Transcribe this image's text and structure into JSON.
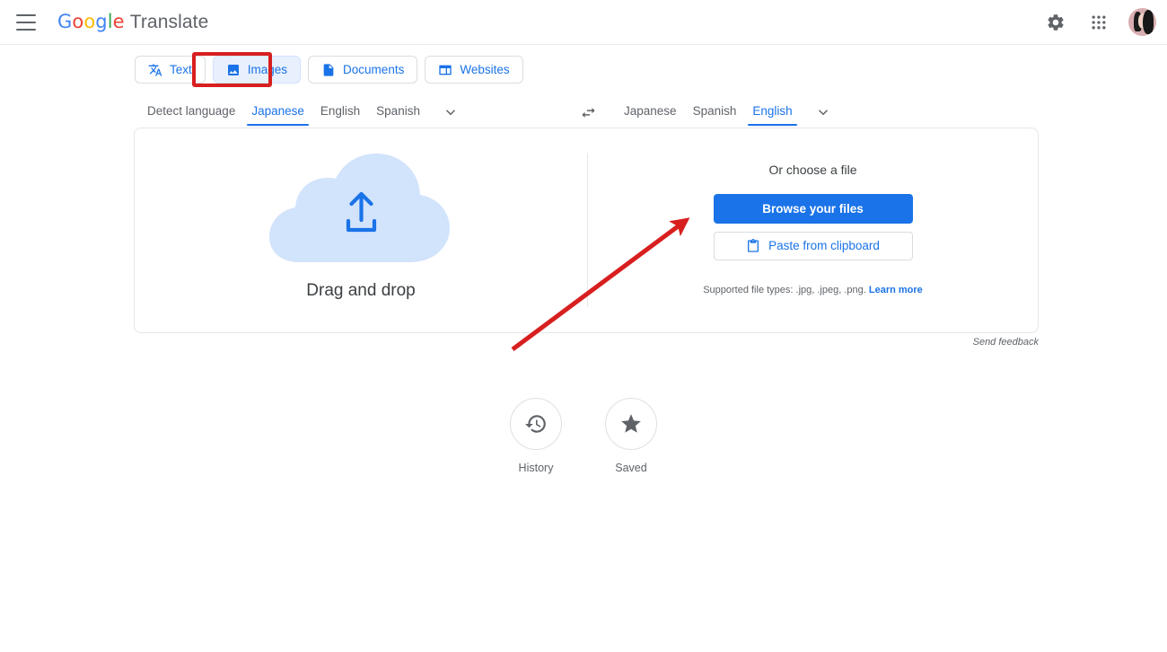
{
  "header": {
    "menu_icon": "hamburger-menu-icon",
    "logo_text": "Google",
    "product_name": "Translate",
    "settings_icon": "gear-icon",
    "apps_icon": "apps-grid-icon",
    "avatar_icon": "user-avatar"
  },
  "tabs": [
    {
      "label": "Text",
      "icon": "translate-icon",
      "active": false
    },
    {
      "label": "Images",
      "icon": "image-icon",
      "active": true
    },
    {
      "label": "Documents",
      "icon": "document-icon",
      "active": false
    },
    {
      "label": "Websites",
      "icon": "website-icon",
      "active": false
    }
  ],
  "source_languages": [
    {
      "label": "Detect language",
      "selected": false
    },
    {
      "label": "Japanese",
      "selected": true
    },
    {
      "label": "English",
      "selected": false
    },
    {
      "label": "Spanish",
      "selected": false
    }
  ],
  "target_languages": [
    {
      "label": "Japanese",
      "selected": false
    },
    {
      "label": "Spanish",
      "selected": false
    },
    {
      "label": "English",
      "selected": true
    }
  ],
  "swap_icon": "swap-languages-icon",
  "more_languages_icon": "chevron-down-icon",
  "dropzone": {
    "cloud_icon": "upload-cloud-icon",
    "label": "Drag and drop"
  },
  "file_picker": {
    "title": "Or choose a file",
    "browse_label": "Browse your files",
    "paste_label": "Paste from clipboard",
    "paste_icon": "clipboard-icon",
    "supported_text": "Supported file types: .jpg, .jpeg, .png.",
    "learn_more_label": "Learn more"
  },
  "send_feedback_label": "Send feedback",
  "shortcuts": [
    {
      "label": "History",
      "icon": "history-clock-icon"
    },
    {
      "label": "Saved",
      "icon": "star-icon"
    }
  ],
  "colors": {
    "brand_blue": "#1a73e8",
    "annotation_red": "#d81f1f",
    "tab_active_bg": "#e8f0fe",
    "cloud_fill": "#d2e3fc"
  }
}
